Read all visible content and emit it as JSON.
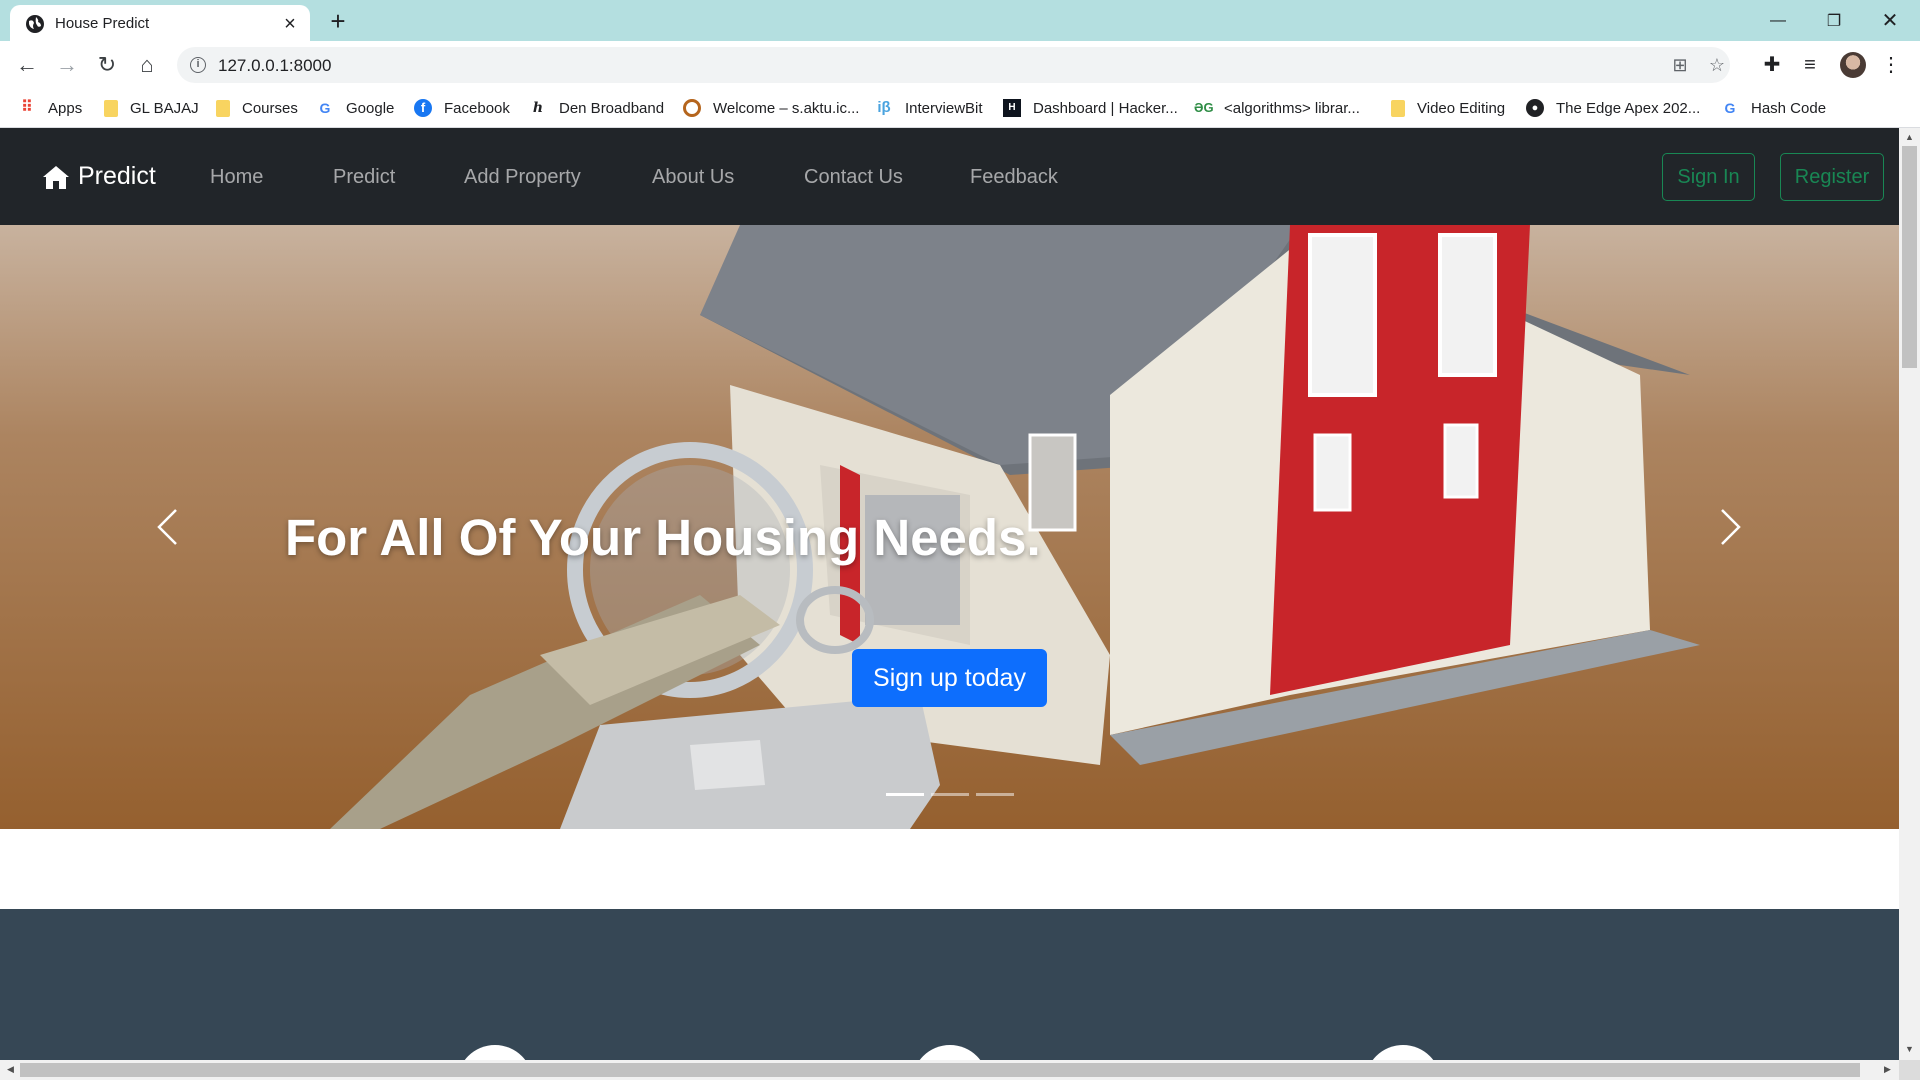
{
  "browser": {
    "tab_title": "House Predict",
    "url": "127.0.0.1:8000",
    "bookmarks": [
      {
        "label": "Apps",
        "icon": "apps-grid-icon"
      },
      {
        "label": "GL BAJAJ",
        "icon": "folder-icon"
      },
      {
        "label": "Courses",
        "icon": "folder-icon"
      },
      {
        "label": "Google",
        "icon": "google-icon"
      },
      {
        "label": "Facebook",
        "icon": "facebook-icon"
      },
      {
        "label": "Den Broadband",
        "icon": "hs-icon"
      },
      {
        "label": "Welcome – s.aktu.ic...",
        "icon": "aktu-icon"
      },
      {
        "label": "InterviewBit",
        "icon": "interviewbit-icon"
      },
      {
        "label": "Dashboard | Hacker...",
        "icon": "hackerrank-icon"
      },
      {
        "label": "<algorithms> librar...",
        "icon": "gfg-icon"
      },
      {
        "label": "Video Editing",
        "icon": "folder-icon"
      },
      {
        "label": "The Edge Apex 202...",
        "icon": "globe-icon"
      },
      {
        "label": "Hash Code",
        "icon": "google-icon"
      }
    ]
  },
  "site": {
    "brand": "Predict",
    "nav": [
      "Home",
      "Predict",
      "Add Property",
      "About Us",
      "Contact Us",
      "Feedback"
    ],
    "sign_in": "Sign In",
    "register": "Register"
  },
  "hero": {
    "heading": "For All Of Your Housing Needs.",
    "cta": "Sign up today",
    "slide_count": 3,
    "active_slide": 1
  },
  "colors": {
    "chrome_title_bar": "#b4dfe0",
    "navbar": "#212529",
    "outline_success": "#198754",
    "primary_button": "#0d6efd",
    "features_bg": "#364755"
  }
}
